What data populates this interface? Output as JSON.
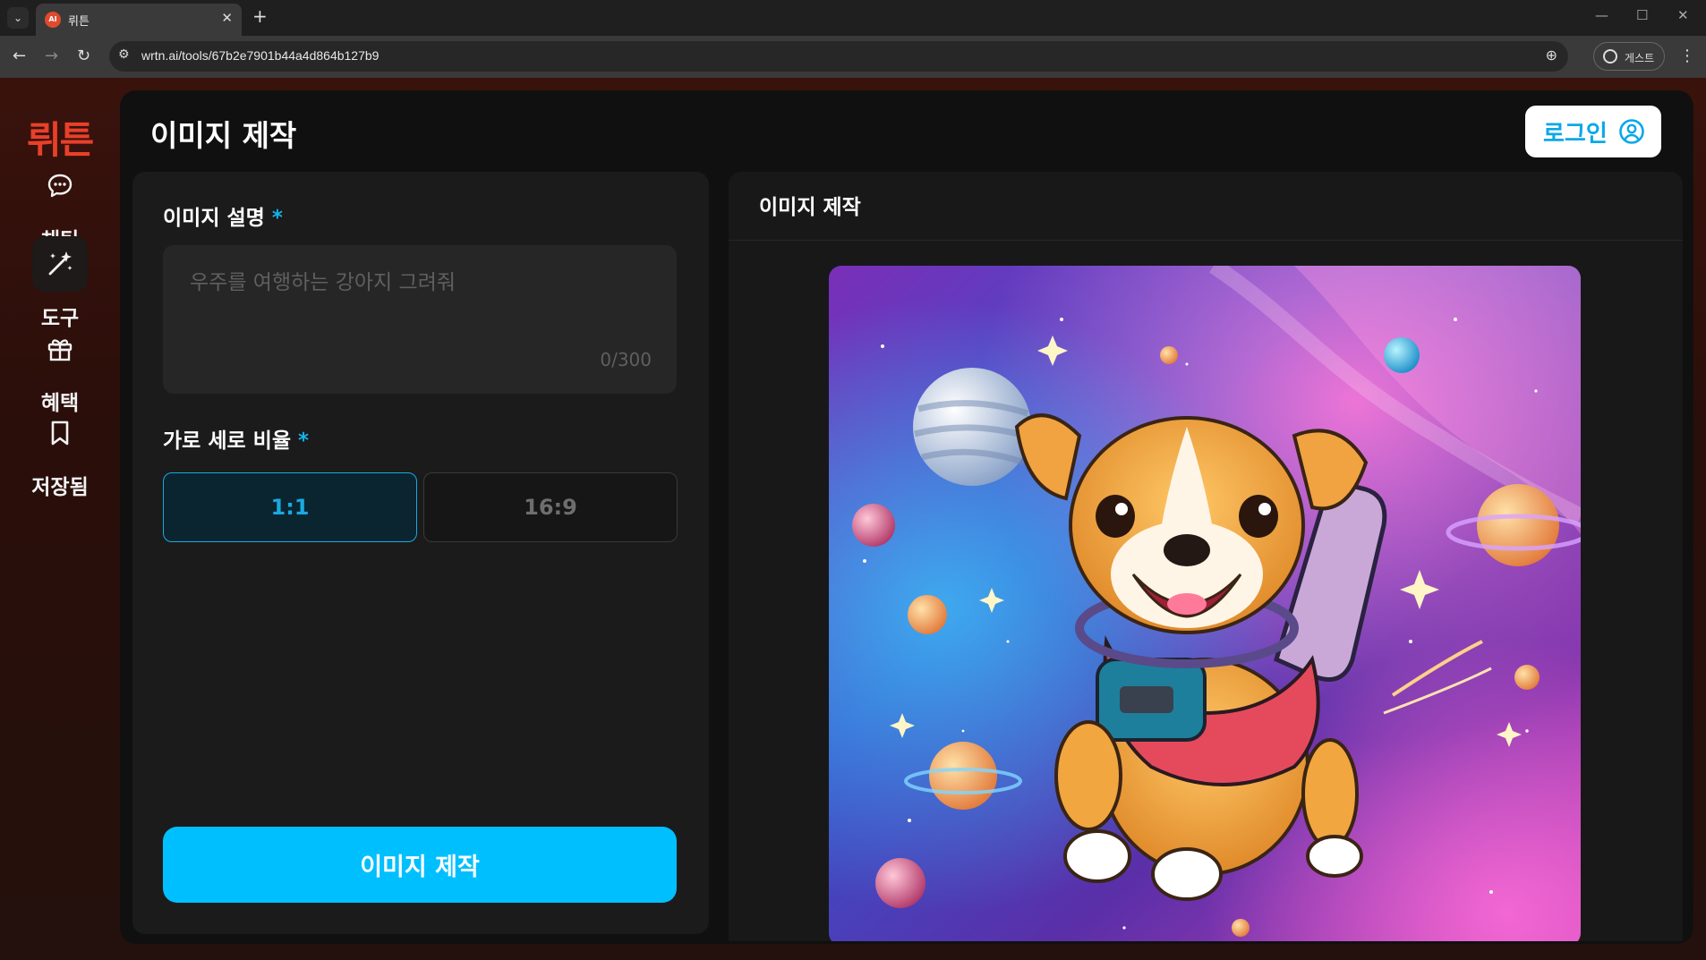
{
  "browser": {
    "tab_title": "뤼튼",
    "favicon_text": "AI",
    "url": "wrtn.ai/tools/67b2e7901b44a4d864b127b9",
    "profile_label": "게스트"
  },
  "sidebar": {
    "logo": "뤼튼",
    "items": [
      {
        "label": "채팅",
        "icon": "chat-bubble-icon"
      },
      {
        "label": "도구",
        "icon": "magic-wand-icon"
      },
      {
        "label": "혜택",
        "icon": "gift-icon"
      },
      {
        "label": "저장됨",
        "icon": "bookmark-icon"
      }
    ]
  },
  "header": {
    "title": "이미지 제작",
    "login_label": "로그인"
  },
  "form": {
    "description_label": "이미지 설명",
    "required_mark": "*",
    "description_placeholder": "우주를 여행하는 강아지 그려줘",
    "char_counter": "0/300",
    "ratio_label": "가로 세로 비율",
    "ratio_options": [
      "1:1",
      "16:9"
    ],
    "selected_ratio": "1:1",
    "submit_label": "이미지 제작"
  },
  "preview": {
    "title": "이미지 제작"
  },
  "colors": {
    "accent": "#00bfff",
    "logo": "#e8402a",
    "panel": "#1b1b1b"
  }
}
